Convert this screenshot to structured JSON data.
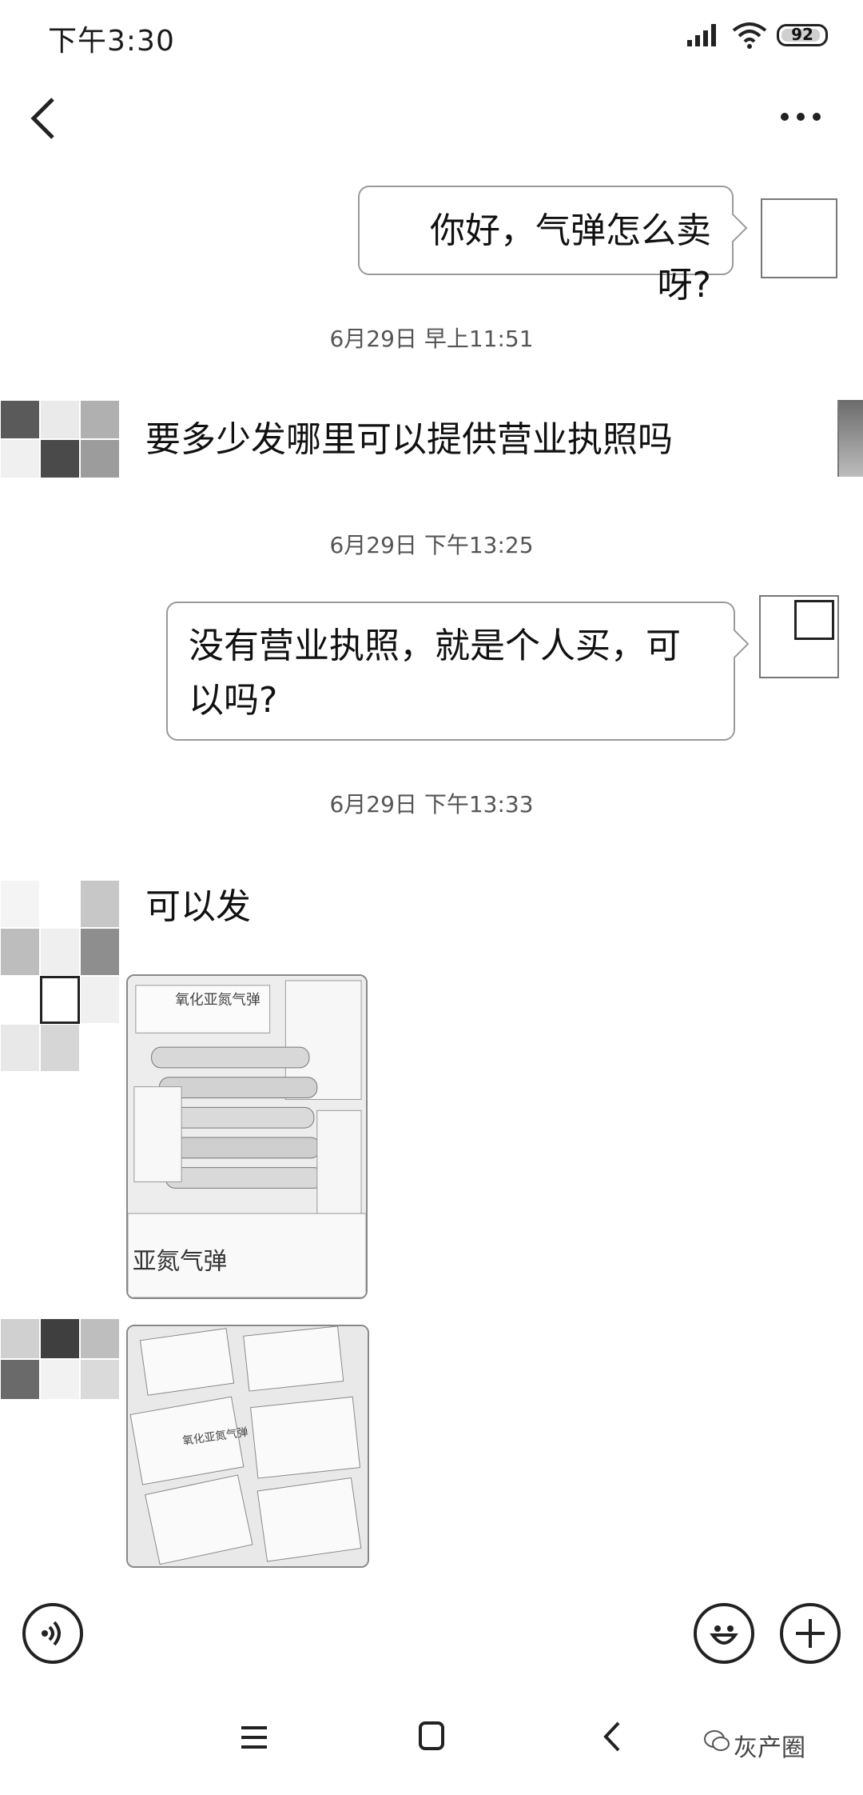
{
  "status_bar": {
    "time": "下午3:30",
    "battery": "92",
    "icons": [
      "signal-icon",
      "wifi-icon",
      "battery-icon"
    ]
  },
  "top_bar": {
    "icons": [
      "back-icon",
      "more-icon"
    ]
  },
  "messages": [
    {
      "direction": "outgoing",
      "text": "你好，气弹怎么卖呀?"
    },
    {
      "timestamp": "6月29日 早上11:51"
    },
    {
      "direction": "incoming",
      "text": "要多少发哪里可以提供营业执照吗"
    },
    {
      "timestamp": "6月29日 下午13:25"
    },
    {
      "direction": "outgoing",
      "text": "没有营业执照，就是个人买，可以吗?"
    },
    {
      "timestamp": "6月29日 下午13:33"
    },
    {
      "direction": "incoming",
      "text": "可以发"
    },
    {
      "direction": "incoming",
      "type": "image",
      "image_text": [
        "氧化亚氮气弹",
        "亚氮气弹"
      ]
    },
    {
      "direction": "incoming",
      "type": "image",
      "image_text": [
        "氧化亚氮气弹"
      ]
    }
  ],
  "input_bar": {
    "icons": [
      "voice-icon",
      "emoji-icon",
      "plus-icon"
    ]
  },
  "nav_bar": {
    "icons": [
      "menu-icon",
      "home-icon",
      "back-nav-icon"
    ],
    "watermark": "灰产圈"
  },
  "colors": {
    "background": "#ffffff",
    "bubble_border": "#9a9a9a",
    "text": "#111111",
    "timestamp": "#555555"
  }
}
